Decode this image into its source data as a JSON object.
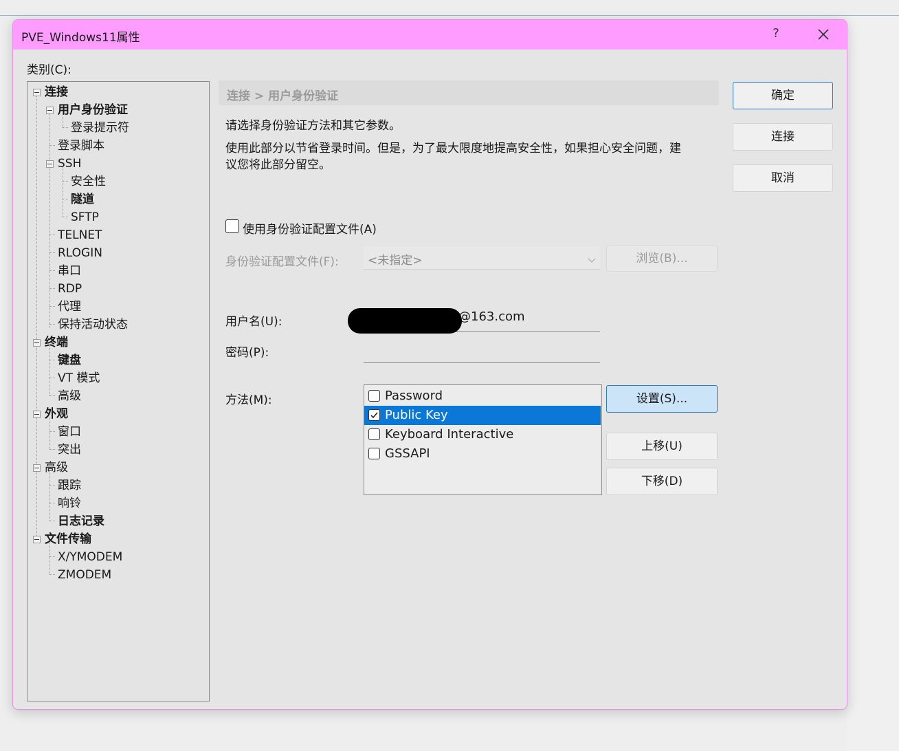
{
  "window": {
    "title": "PVE_Windows11属性",
    "help": "?"
  },
  "category_label": "类别(C):",
  "tree": [
    "连接",
    "用户身份验证",
    "登录提示符",
    "登录脚本",
    "SSH",
    "安全性",
    "隧道",
    "SFTP",
    "TELNET",
    "RLOGIN",
    "串口",
    "RDP",
    "代理",
    "保持活动状态",
    "终端",
    "键盘",
    "VT 模式",
    "高级",
    "外观",
    "窗口",
    "突出",
    "高级",
    "跟踪",
    "响铃",
    "日志记录",
    "文件传输",
    "X/YMODEM",
    "ZMODEM"
  ],
  "breadcrumb": "连接 > 用户身份验证",
  "description": {
    "line1": "请选择身份验证方法和其它参数。",
    "line2a": "使用此部分以节省登录时间。但是，为了最大限度地提高安全性，如果担心安全问题，建",
    "line2b": "议您将此部分留空。"
  },
  "profile": {
    "checkbox_label": "使用身份验证配置文件(A)",
    "checked": false,
    "file_label": "身份验证配置文件(F):",
    "select_value": "<未指定>",
    "browse": "浏览(B)..."
  },
  "username": {
    "label": "用户名(U):",
    "value": "@163.com"
  },
  "password": {
    "label": "密码(P):",
    "value": ""
  },
  "method": {
    "label": "方法(M):",
    "items": [
      {
        "name": "Password",
        "checked": false,
        "selected": false
      },
      {
        "name": "Public Key",
        "checked": true,
        "selected": true
      },
      {
        "name": "Keyboard Interactive",
        "checked": false,
        "selected": false
      },
      {
        "name": "GSSAPI",
        "checked": false,
        "selected": false
      }
    ],
    "settings": "设置(S)...",
    "move_up": "上移(U)",
    "move_down": "下移(D)"
  },
  "buttons": {
    "ok": "确定",
    "connect": "连接",
    "cancel": "取消"
  },
  "colors": {
    "titlebar": "#ff9cff",
    "selection": "#0b78d7",
    "dialog_bg": "#e5e5e5"
  }
}
